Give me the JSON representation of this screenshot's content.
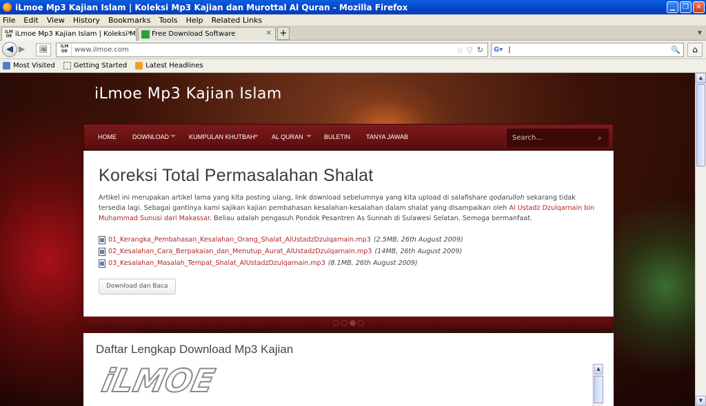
{
  "window": {
    "title": "iLmoe Mp3 Kajian Islam | Koleksi Mp3 Kajian dan Murottal Al Quran - Mozilla Firefox"
  },
  "menu": [
    "File",
    "Edit",
    "View",
    "History",
    "Bookmarks",
    "Tools",
    "Help",
    "Related Links"
  ],
  "tabs": [
    {
      "label": "iLmoe Mp3 Kajian Islam | Koleksi Mp3 Kaji...",
      "active": true,
      "icon": "ilmoe-favicon"
    },
    {
      "label": "Free Download Software",
      "active": false,
      "icon": "green-favicon"
    }
  ],
  "nav": {
    "url": "www.ilmoe.com",
    "search_value": "|"
  },
  "bookmarks": [
    {
      "label": "Most Visited",
      "icon": "folder-icon"
    },
    {
      "label": "Getting Started",
      "icon": "page-icon"
    },
    {
      "label": "Latest Headlines",
      "icon": "rss-icon"
    }
  ],
  "site": {
    "title": "iLmoe Mp3 Kajian Islam",
    "nav": [
      {
        "label": "HOME",
        "has_dropdown": false
      },
      {
        "label": "DOWNLOAD",
        "has_dropdown": true
      },
      {
        "label": "KUMPULAN KHUTBAH",
        "has_dropdown": true
      },
      {
        "label": "AL QURAN",
        "has_dropdown": true
      },
      {
        "label": "BULETIN",
        "has_dropdown": false
      },
      {
        "label": "TANYA JAWAB",
        "has_dropdown": false
      }
    ],
    "search_placeholder": "Search..."
  },
  "article": {
    "title": "Koreksi Total Permasalahan Shalat",
    "p1": "Artikel ini merupakan artikel lama yang kita posting ulang, link download sebelumnya yang kita upload di salafishare ",
    "p_italic": "qodarulloh",
    "p2": " sekarang tidak tersedia lagi. Sebagai gantinya kami sajikan kajian pembahasan kesalahan-kesalahan dalam shalat yang disampaikan oleh ",
    "p_link": "Al Ustadz Dzulqarnain bin Muhammad Sunusi dari Makassar",
    "p3": ". Beliau adalah pengasuh Pondok Pesantren As Sunnah di Sulawesi Selatan. Semoga bermanfaat.",
    "files": [
      {
        "name": "01_Kerangka_Pembahasan_Kesalahan_Orang_Shalat_AlUstadzDzulqarnain.mp3",
        "meta": "(2.5MB, 26th August 2009)"
      },
      {
        "name": "02_Kesalahan_Cara_Berpakaian_dan_Menutup_Aurat_AlUstadzDzulqarnain.mp3",
        "meta": "(14MB, 26th August 2009)"
      },
      {
        "name": "03_Kesalahan_Masalah_Tempat_Shalat_AlUstadzDzulqarnain.mp3",
        "meta": "(8.1MB, 26th August 2009)"
      }
    ],
    "button": "Download dan Baca"
  },
  "slider": {
    "count": 4,
    "active": 2
  },
  "list": {
    "title": "Daftar Lengkap Download Mp3 Kajian",
    "logo_text": "iLMOE"
  }
}
